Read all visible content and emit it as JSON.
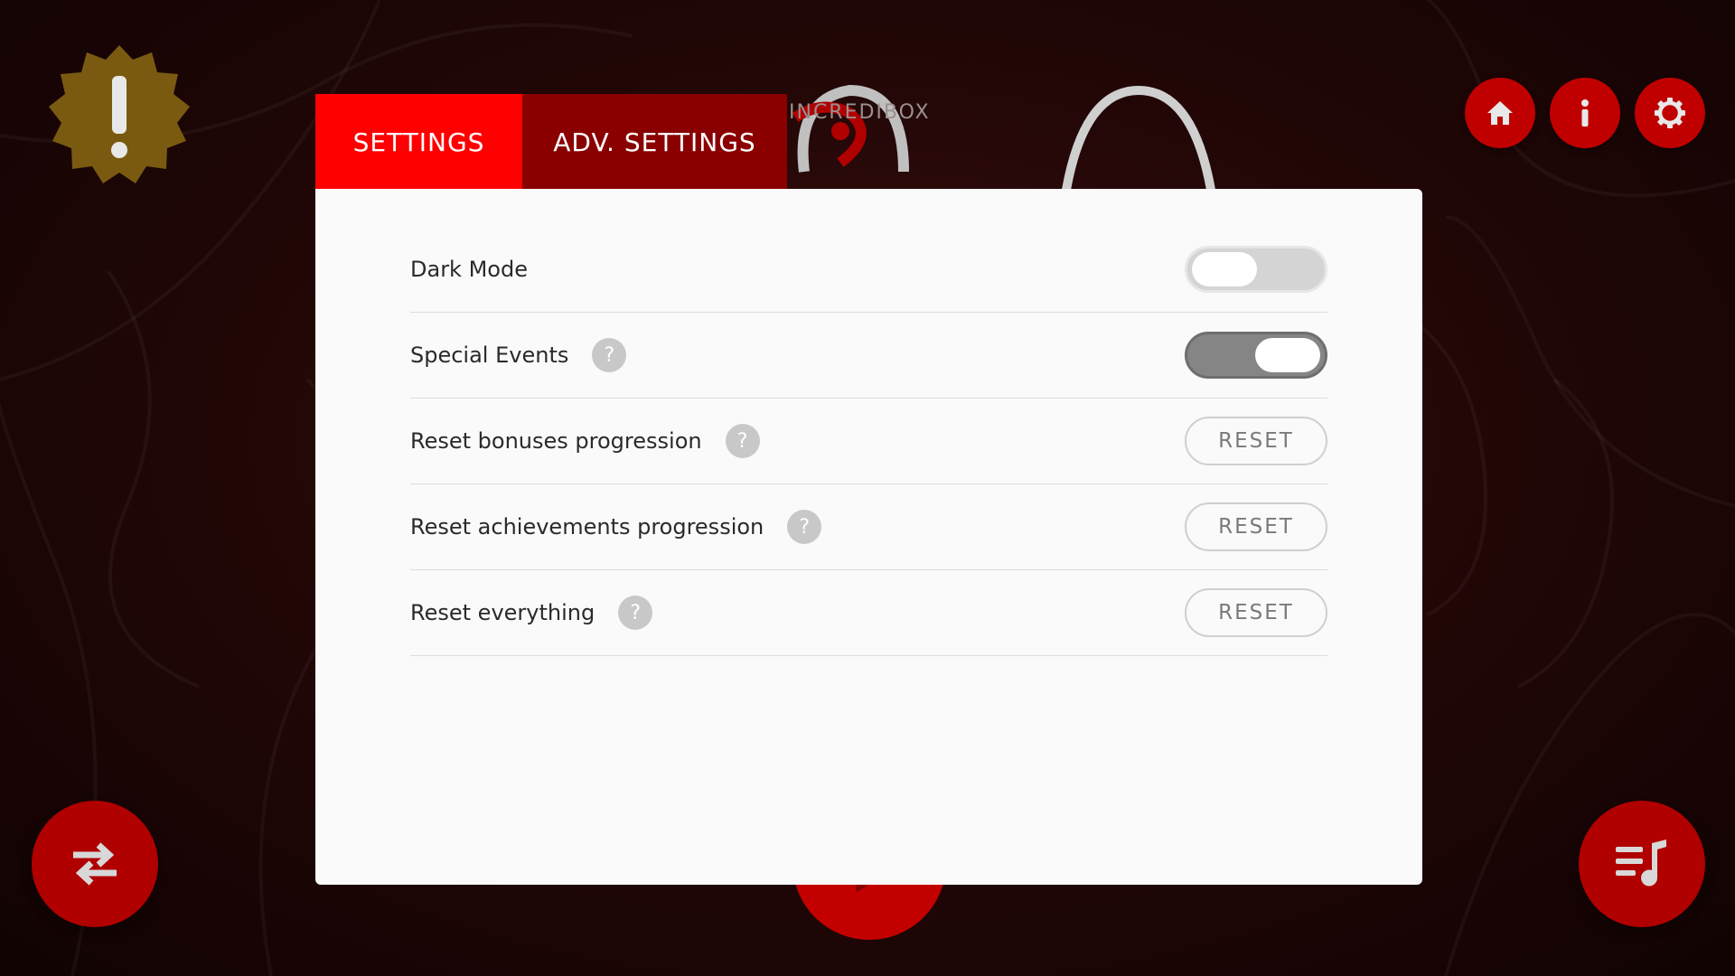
{
  "background": {
    "logo_text": "INCREDIBOX"
  },
  "alert_badge": {
    "icon": "exclamation-icon",
    "color": "#7a5a10"
  },
  "top_nav": [
    {
      "name": "home-button",
      "icon": "home-icon"
    },
    {
      "name": "info-button",
      "icon": "info-icon"
    },
    {
      "name": "settings-button",
      "icon": "gear-icon"
    }
  ],
  "dialog": {
    "tabs": [
      {
        "label": "SETTINGS",
        "active": true
      },
      {
        "label": "ADV. SETTINGS",
        "active": false
      }
    ],
    "rows": [
      {
        "label": "Dark Mode",
        "control": "toggle",
        "on": false,
        "help": false
      },
      {
        "label": "Special Events",
        "control": "toggle",
        "on": true,
        "help": true
      },
      {
        "label": "Reset bonuses progression",
        "control": "button",
        "button_label": "RESET",
        "help": true
      },
      {
        "label": "Reset achievements progression",
        "control": "button",
        "button_label": "RESET",
        "help": true
      },
      {
        "label": "Reset everything",
        "control": "button",
        "button_label": "RESET",
        "help": true
      }
    ],
    "help_glyph": "?"
  },
  "bottom_controls": {
    "left": {
      "icon": "swap-arrows-icon"
    },
    "right": {
      "icon": "playlist-music-icon"
    }
  },
  "colors": {
    "accent": "#ff0000",
    "tab_inactive": "#8a0000",
    "button_red": "#c00000"
  }
}
